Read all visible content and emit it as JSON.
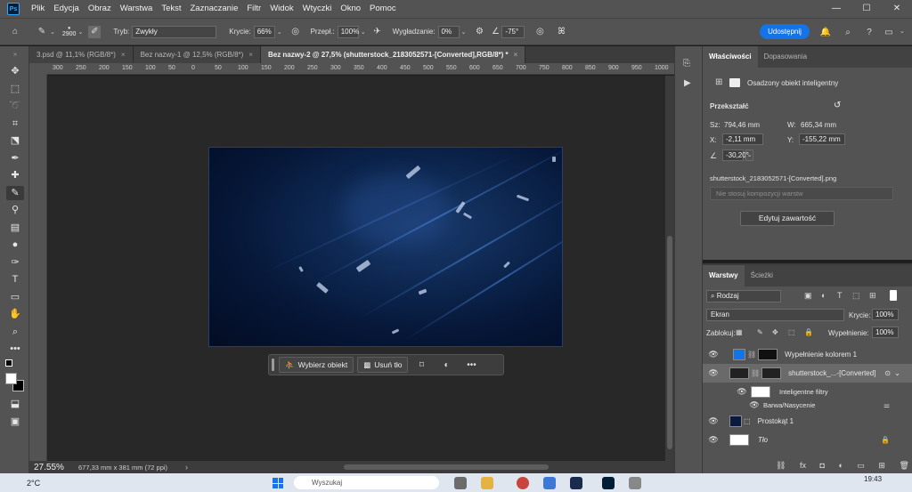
{
  "menu": {
    "logo": "Ps",
    "items": [
      "Plik",
      "Edycja",
      "Obraz",
      "Warstwa",
      "Tekst",
      "Zaznaczanie",
      "Filtr",
      "Widok",
      "Wtyczki",
      "Okno",
      "Pomoc"
    ]
  },
  "options": {
    "brush_size": "2900",
    "mode_label": "Tryb:",
    "mode_value": "Zwykły",
    "opacity_label": "Krycie:",
    "opacity_value": "66%",
    "flow_label": "Przepł.:",
    "flow_value": "100%",
    "smoothing_label": "Wygładzanie:",
    "smoothing_value": "0%",
    "angle_value": "-75°",
    "share_label": "Udostępnij"
  },
  "tabs": [
    {
      "label": "3.psd @ 11,1% (RGB/8*)",
      "active": false
    },
    {
      "label": "Bez nazwy-1 @ 12,5% (RGB/8*)",
      "active": false
    },
    {
      "label": "Bez nazwy-2 @ 27,5% (shutterstock_2183052571-[Converted],RGB/8*) *",
      "active": true
    }
  ],
  "ruler_ticks": [
    "300",
    "250",
    "200",
    "150",
    "100",
    "50",
    "0",
    "50",
    "100",
    "150",
    "200",
    "250",
    "300",
    "350",
    "400",
    "450",
    "500",
    "550",
    "600",
    "650",
    "700",
    "750",
    "800",
    "850",
    "900",
    "950",
    "1000"
  ],
  "context_bar": {
    "select_subject": "Wybierz obiekt",
    "remove_bg": "Usuń tło"
  },
  "status": {
    "zoom": "27.55%",
    "dimensions": "677,33 mm x 381 mm (72 ppi)"
  },
  "properties": {
    "tab_properties": "Właściwości",
    "tab_adjustments": "Dopasowania",
    "object_type": "Osadzony obiekt inteligentny",
    "transform_label": "Przekształć",
    "w_label": "Sz:",
    "w_value": "794,46 mm",
    "h_label": "W:",
    "h_value": "665,34 mm",
    "x_label": "X:",
    "x_value": "-2,11 mm",
    "y_label": "Y:",
    "y_value": "-155,22 mm",
    "angle_value": "-30,20°",
    "filename": "shutterstock_2183052571-[Converted].png",
    "comp_placeholder": "Nie stosuj kompozycji warstw",
    "edit_contents": "Edytuj zawartość"
  },
  "layers_panel": {
    "tab_layers": "Warstwy",
    "tab_paths": "Ścieżki",
    "kind_filter": "Rodzaj",
    "blend_mode": "Ekran",
    "opacity_label": "Krycie:",
    "opacity_value": "100%",
    "lock_label": "Zablokuj:",
    "fill_label": "Wypełnienie:",
    "fill_value": "100%",
    "layers": [
      {
        "name": "Wypełnienie kolorem 1"
      },
      {
        "name": "shutterstock_...-[Converted]"
      },
      {
        "name": "Inteligentne filtry"
      },
      {
        "name": "Barwa/Nasycenie"
      },
      {
        "name": "Prostokąt 1"
      },
      {
        "name": "Tło"
      }
    ]
  },
  "taskbar": {
    "weather": "2°C",
    "search_placeholder": "Wyszukaj",
    "time": "19:43"
  },
  "colors": {
    "accent": "#1473e6",
    "fill_layer_color": "#1473e6",
    "canvas_bg": "#0d2750"
  }
}
